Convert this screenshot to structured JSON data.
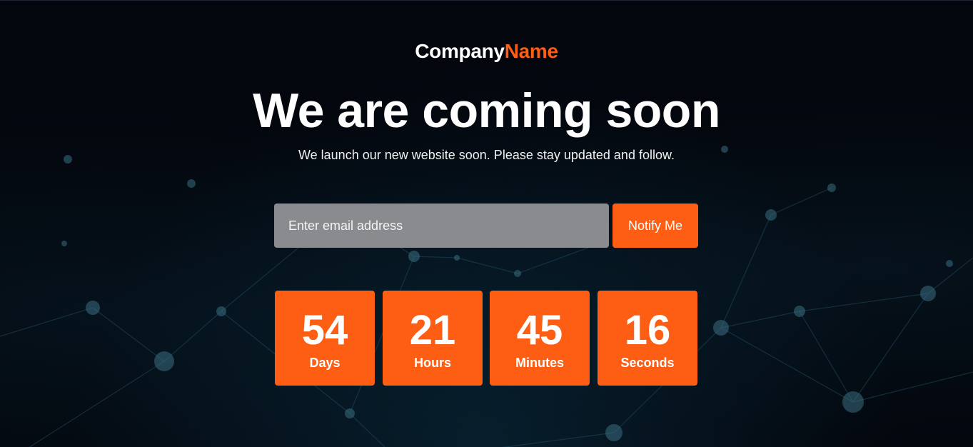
{
  "brand": {
    "name_part1": "Company",
    "name_part2": "Name",
    "accent_color": "#fd5e14"
  },
  "hero": {
    "title": "We are coming soon",
    "subtitle": "We launch our new website soon. Please stay updated and follow."
  },
  "subscribe": {
    "email_placeholder": "Enter email address",
    "email_value": "",
    "button_label": "Notify Me"
  },
  "countdown": {
    "days": {
      "value": "54",
      "label": "Days"
    },
    "hours": {
      "value": "21",
      "label": "Hours"
    },
    "minutes": {
      "value": "45",
      "label": "Minutes"
    },
    "seconds": {
      "value": "16",
      "label": "Seconds"
    }
  },
  "colors": {
    "background": "#03060d",
    "accent": "#fd5e14",
    "input_bg": "#898b8f"
  }
}
